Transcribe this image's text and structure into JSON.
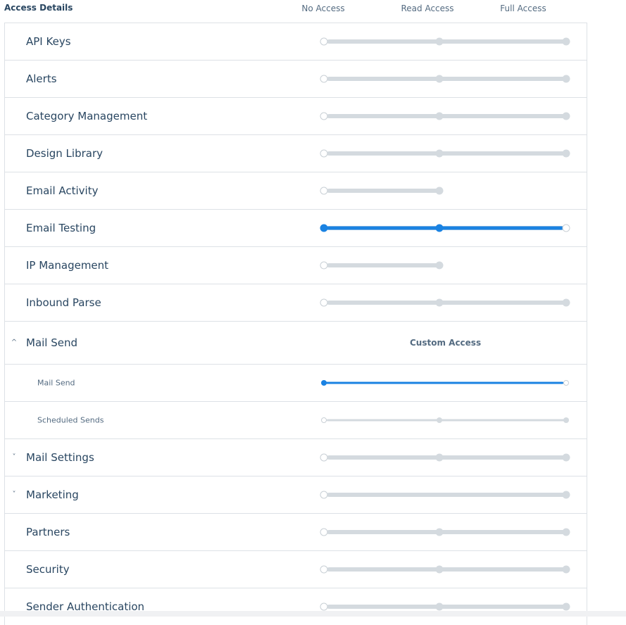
{
  "header": {
    "title": "Access Details",
    "levels": [
      "No Access",
      "Read Access",
      "Full Access"
    ]
  },
  "rows": [
    {
      "label": "API Keys",
      "type": "main",
      "stops": 3,
      "value": 0
    },
    {
      "label": "Alerts",
      "type": "main",
      "stops": 3,
      "value": 0
    },
    {
      "label": "Category Management",
      "type": "main",
      "stops": 3,
      "value": 0
    },
    {
      "label": "Design Library",
      "type": "main",
      "stops": 3,
      "value": 0
    },
    {
      "label": "Email Activity",
      "type": "main",
      "stops": 2,
      "value": 0
    },
    {
      "label": "Email Testing",
      "type": "main",
      "stops": 3,
      "value": 2
    },
    {
      "label": "IP Management",
      "type": "main",
      "stops": 2,
      "value": 0
    },
    {
      "label": "Inbound Parse",
      "type": "main",
      "stops": 3,
      "value": 0
    },
    {
      "label": "Mail Send",
      "type": "group-expanded",
      "chevron": "^",
      "custom": "Custom Access"
    },
    {
      "label": "Mail Send",
      "type": "sub",
      "stops": 2,
      "value": 1,
      "full_width": true
    },
    {
      "label": "Scheduled Sends",
      "type": "sub",
      "stops": 3,
      "value": 0
    },
    {
      "label": "Mail Settings",
      "type": "group-collapsed",
      "chevron": "˅",
      "stops": 3,
      "value": 0
    },
    {
      "label": "Marketing",
      "type": "group-collapsed",
      "chevron": "˅",
      "stops": 2,
      "value": 0,
      "full_width": true
    },
    {
      "label": "Partners",
      "type": "main",
      "stops": 3,
      "value": 0
    },
    {
      "label": "Security",
      "type": "main",
      "stops": 3,
      "value": 0
    },
    {
      "label": "Sender Authentication",
      "type": "main",
      "stops": 3,
      "value": 0
    }
  ],
  "colors": {
    "accent": "#1a82e2",
    "track": "#d4dadf",
    "text": "#294661"
  }
}
